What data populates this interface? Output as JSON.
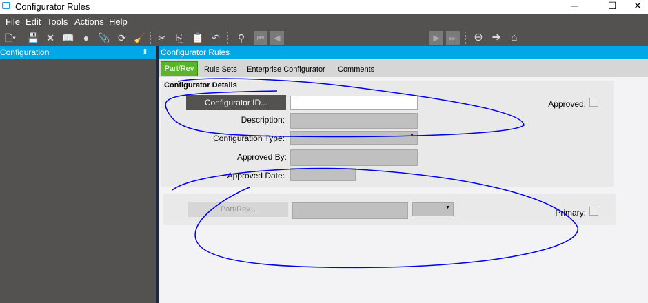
{
  "window": {
    "title": "Configurator Rules",
    "minimize": "─",
    "maximize": "☐",
    "close": "✕"
  },
  "menu": [
    "File",
    "Edit",
    "Tools",
    "Actions",
    "Help"
  ],
  "toolbar": {
    "search_value": ""
  },
  "left_panel": {
    "title": "Configuration",
    "pin": "📌"
  },
  "main": {
    "title": "Configurator Rules",
    "tabs": [
      "Part/Rev",
      "Rule Sets",
      "Enterprise Configurator",
      "Comments"
    ],
    "details": {
      "heading": "Configurator Details",
      "configurator_id_button": "Configurator ID...",
      "configurator_id_value": "",
      "description_label": "Description:",
      "configuration_type_label": "Configuration Type:",
      "approved_by_label": "Approved By:",
      "approved_date_label": "Approved Date:",
      "approved_label": "Approved:",
      "approved_checked": false
    },
    "partrev": {
      "button": "Part/Rev...",
      "primary_label": "Primary:",
      "primary_checked": false
    }
  },
  "colors": {
    "accent": "#00a8e8",
    "active_tab": "#5ab52a",
    "chrome": "#545250",
    "annotation": "#0000ee"
  }
}
